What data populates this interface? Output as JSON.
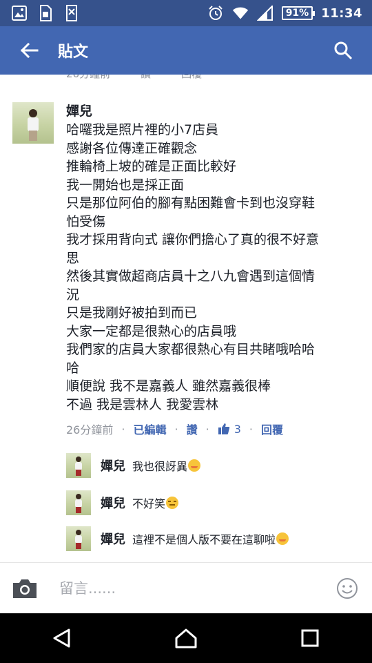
{
  "status_bar": {
    "battery": "91%",
    "time": "11:34",
    "icons": [
      "gallery-icon",
      "sim-icon",
      "sd-card-icon",
      "alarm-icon",
      "wifi-icon",
      "signal-icon"
    ]
  },
  "app_bar": {
    "title": "貼文",
    "back_icon": "back-arrow-icon",
    "search_icon": "search-icon"
  },
  "previous_comment_meta": {
    "time": "26分鐘前",
    "like": "讚",
    "reply": "回覆"
  },
  "comment": {
    "author": "嬋兒",
    "lines": [
      "哈囉我是照片裡的小7店員",
      "感謝各位傳達正確觀念",
      "推輪椅上坡的確是正面比較好",
      "我一開始也是採正面",
      "只是那位阿伯的腳有點困難會卡到也沒穿鞋",
      "怕受傷",
      "我才採用背向式 讓你們擔心了真的很不好意",
      "思",
      "然後其實做超商店員十之八九會遇到這個情",
      "況",
      "只是我剛好被拍到而已",
      "大家一定都是很熱心的店員哦",
      "我們家的店員大家都很熱心有目共睹哦哈哈",
      "哈",
      "順便說 我不是嘉義人 雖然嘉義很棒",
      "不過 我是雲林人 我愛雲林"
    ],
    "time": "26分鐘前",
    "edited": "已編輯",
    "like": "讚",
    "like_count": "3",
    "reply": "回覆"
  },
  "replies": [
    {
      "author": "嬋兒",
      "text": "我也很訝異",
      "emoji": "blush-emoji-icon"
    },
    {
      "author": "嬋兒",
      "text": "不好笑",
      "emoji": "unamused-emoji-icon"
    },
    {
      "author": "嬋兒",
      "text": "這裡不是個人版不要在這聊啦",
      "emoji": "blush-emoji-icon"
    }
  ],
  "composer": {
    "placeholder": "留言......",
    "camera_icon": "camera-icon",
    "emoji_icon": "smiley-icon"
  },
  "nav_bar": {
    "icons": [
      "back-triangle-icon",
      "home-icon",
      "recents-icon"
    ]
  },
  "colors": {
    "status_bar": "#36528c",
    "app_bar": "#4267b2",
    "link": "#4267b2",
    "meta_gray": "#90949c",
    "text": "#1d2129"
  }
}
